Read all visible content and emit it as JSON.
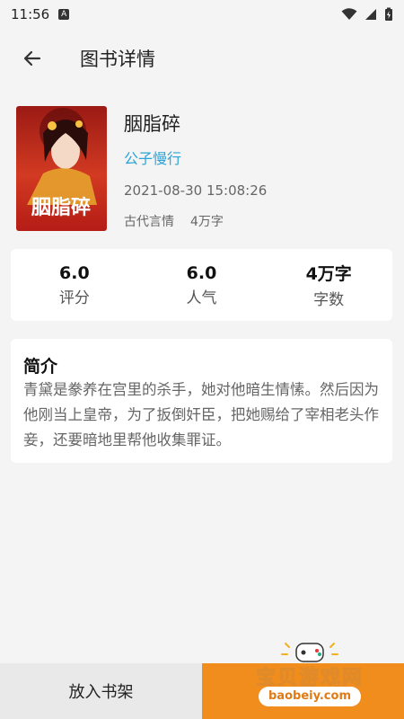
{
  "status": {
    "time": "11:56",
    "a_icon": "A"
  },
  "appbar": {
    "title": "图书详情"
  },
  "book": {
    "title": "胭脂碎",
    "author": "公子慢行",
    "date": "2021-08-30 15:08:26",
    "category": "古代言情",
    "word_count": "4万字",
    "cover_title": "胭脂碎"
  },
  "stats": [
    {
      "value": "6.0",
      "label": "评分"
    },
    {
      "value": "6.0",
      "label": "人气"
    },
    {
      "value": "4万字",
      "label": "字数"
    }
  ],
  "intro": {
    "title": "简介",
    "text": "青黛是豢养在宫里的杀手，她对他暗生情愫。然后因为他刚当上皇帝，为了扳倒奸臣，把她赐给了宰相老头作妾，还要暗地里帮他收集罪证。"
  },
  "bottom": {
    "shelf_label": "放入书架"
  },
  "watermark": {
    "text": "宝贝游戏网",
    "url": "baobeiy.com"
  },
  "colors": {
    "accent": "#2aa4d8",
    "orange": "#f08d1c",
    "cover_red": "#c8241c"
  }
}
